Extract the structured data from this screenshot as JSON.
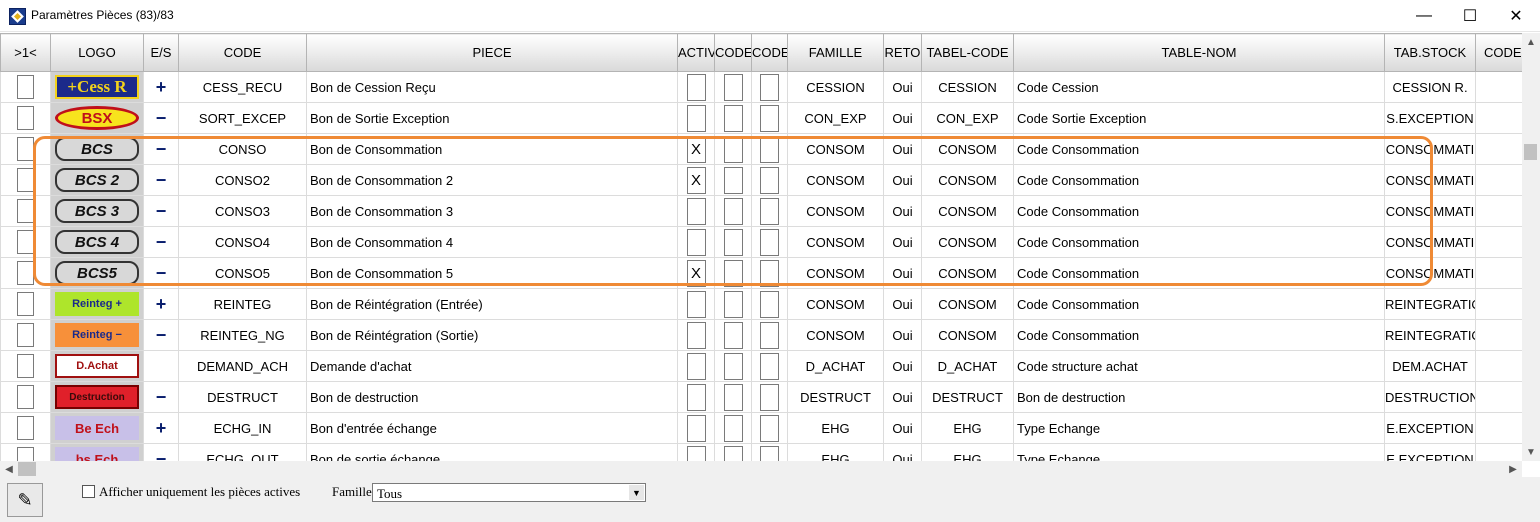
{
  "window": {
    "title": "Paramètres Pièces (83)/83",
    "minimize_icon": "minimize-icon",
    "maximize_icon": "maximize-icon",
    "close_icon": "close-icon"
  },
  "columns": [
    "&gt;1&lt;",
    "LOGO",
    "E/S",
    "CODE",
    "PIECE",
    "ACTIV",
    "CODE",
    "CODE",
    "FAMILLE",
    "RETO",
    "TABEL-CODE",
    "TABLE-NOM",
    "TAB.STOCK",
    "CODE-REG"
  ],
  "rows": [
    {
      "logo": "+Cess R",
      "es": "+",
      "code": "CESS_RECU",
      "piece": "Bon de Cession Reçu",
      "activ": "",
      "famille": "CESSION",
      "reto": "Oui",
      "tabel_code": "CESSION",
      "table_nom": "Code Cession",
      "tab_stock": "CESSION R."
    },
    {
      "logo": "BSX",
      "es": "−",
      "code": "SORT_EXCEP",
      "piece": "Bon de Sortie Exception",
      "activ": "",
      "famille": "CON_EXP",
      "reto": "Oui",
      "tabel_code": "CON_EXP",
      "table_nom": "Code Sortie Exception",
      "tab_stock": "S.EXCEPTION"
    },
    {
      "logo": "BCS",
      "es": "−",
      "code": "CONSO",
      "piece": "Bon de Consommation",
      "activ": "X",
      "famille": "CONSOM",
      "reto": "Oui",
      "tabel_code": "CONSOM",
      "table_nom": "Code Consommation",
      "tab_stock": "CONSOMMATI"
    },
    {
      "logo": "BCS 2",
      "es": "−",
      "code": "CONSO2",
      "piece": "Bon de Consommation 2",
      "activ": "X",
      "famille": "CONSOM",
      "reto": "Oui",
      "tabel_code": "CONSOM",
      "table_nom": "Code Consommation",
      "tab_stock": "CONSOMMATI"
    },
    {
      "logo": "BCS 3",
      "es": "−",
      "code": "CONSO3",
      "piece": "Bon de Consommation 3",
      "activ": "",
      "famille": "CONSOM",
      "reto": "Oui",
      "tabel_code": "CONSOM",
      "table_nom": "Code Consommation",
      "tab_stock": "CONSOMMATI"
    },
    {
      "logo": "BCS 4",
      "es": "−",
      "code": "CONSO4",
      "piece": "Bon de Consommation 4",
      "activ": "",
      "famille": "CONSOM",
      "reto": "Oui",
      "tabel_code": "CONSOM",
      "table_nom": "Code Consommation",
      "tab_stock": "CONSOMMATI"
    },
    {
      "logo": "BCS5",
      "es": "−",
      "code": "CONSO5",
      "piece": "Bon de Consommation 5",
      "activ": "X",
      "famille": "CONSOM",
      "reto": "Oui",
      "tabel_code": "CONSOM",
      "table_nom": "Code Consommation",
      "tab_stock": "CONSOMMATI"
    },
    {
      "logo": "Reinteg +",
      "es": "+",
      "code": "REINTEG",
      "piece": "Bon de Réintégration (Entrée)",
      "activ": "",
      "famille": "CONSOM",
      "reto": "Oui",
      "tabel_code": "CONSOM",
      "table_nom": "Code Consommation",
      "tab_stock": "REINTEGRATIO"
    },
    {
      "logo": "Reinteg −",
      "es": "−",
      "code": "REINTEG_NG",
      "piece": "Bon de Réintégration (Sortie)",
      "activ": "",
      "famille": "CONSOM",
      "reto": "Oui",
      "tabel_code": "CONSOM",
      "table_nom": "Code Consommation",
      "tab_stock": "REINTEGRATIO"
    },
    {
      "logo": "D.Achat",
      "es": "",
      "code": "DEMAND_ACH",
      "piece": "Demande d'achat",
      "activ": "",
      "famille": "D_ACHAT",
      "reto": "Oui",
      "tabel_code": "D_ACHAT",
      "table_nom": "Code structure achat",
      "tab_stock": "DEM.ACHAT"
    },
    {
      "logo": "Destruction",
      "es": "−",
      "code": "DESTRUCT",
      "piece": "Bon de destruction",
      "activ": "",
      "famille": "DESTRUCT",
      "reto": "Oui",
      "tabel_code": "DESTRUCT",
      "table_nom": "Bon de destruction",
      "tab_stock": "DESTRUCTION"
    },
    {
      "logo": "Be Ech",
      "es": "+",
      "code": "ECHG_IN",
      "piece": "Bon d'entrée échange",
      "activ": "",
      "famille": "EHG",
      "reto": "Oui",
      "tabel_code": "EHG",
      "table_nom": "Type Echange",
      "tab_stock": "E.EXCEPTION"
    },
    {
      "logo": "bs Ech",
      "es": "−",
      "code": "ECHG_OUT",
      "piece": "Bon de sortie échange",
      "activ": "",
      "famille": "EHG",
      "reto": "Oui",
      "tabel_code": "EHG",
      "table_nom": "Type Echange",
      "tab_stock": "E.EXCEPTION"
    }
  ],
  "bottom": {
    "edit_icon": "edit-icon",
    "active_only_label": "Afficher uniquement les pièces actives",
    "famille_label": "Famille:",
    "famille_value": "Tous"
  },
  "colors": {
    "highlight": "#ef8a35",
    "header_grad_top": "#ffffff",
    "header_grad_bottom": "#d9d9d9"
  }
}
